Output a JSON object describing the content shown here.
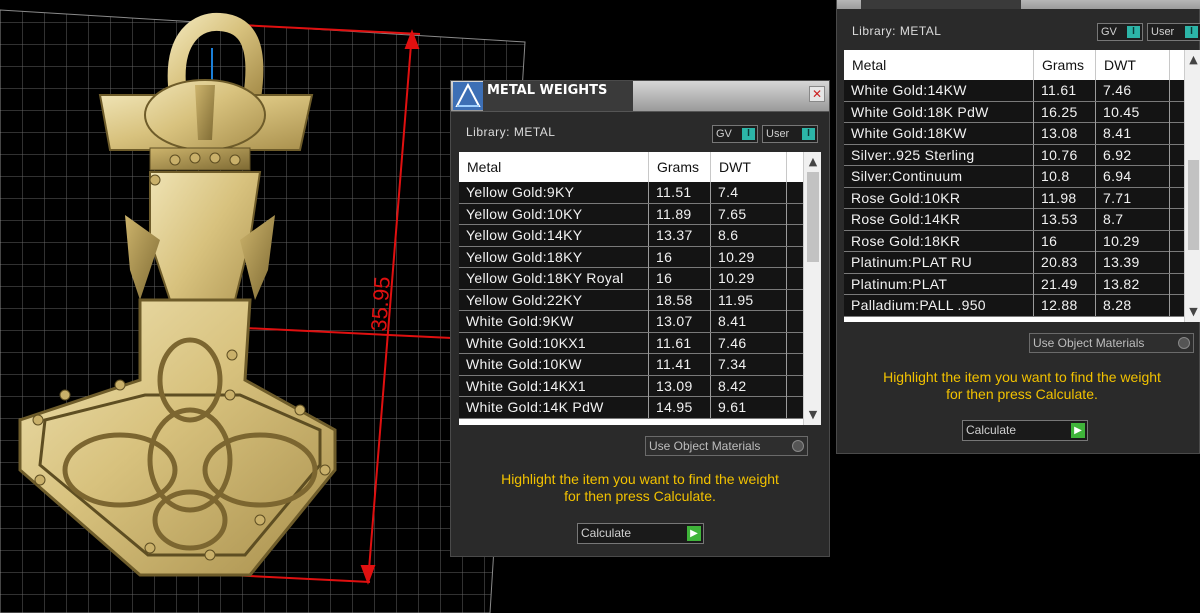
{
  "measurement": {
    "value": "35.95"
  },
  "colors": {
    "accent_green": "#3fb43a",
    "toggle_teal": "#2cb5a8",
    "hint_yellow": "#f2c200",
    "dim_red": "#e01010"
  },
  "main_dialog": {
    "title": "METAL WEIGHTS",
    "close_glyph": "✕",
    "library_label": "Library: METAL",
    "toggle_gv": "GV",
    "toggle_user": "User",
    "toggle_knob": "I",
    "columns": [
      "Metal",
      "Grams",
      "DWT"
    ],
    "rows": [
      [
        "Yellow Gold:9KY",
        "11.51",
        "7.4"
      ],
      [
        "Yellow Gold:10KY",
        "11.89",
        "7.65"
      ],
      [
        "Yellow Gold:14KY",
        "13.37",
        "8.6"
      ],
      [
        "Yellow Gold:18KY",
        "16",
        "10.29"
      ],
      [
        "Yellow Gold:18KY Royal",
        "16",
        "10.29"
      ],
      [
        "Yellow Gold:22KY",
        "18.58",
        "11.95"
      ],
      [
        "White Gold:9KW",
        "13.07",
        "8.41"
      ],
      [
        "White Gold:10KX1",
        "11.61",
        "7.46"
      ],
      [
        "White Gold:10KW",
        "11.41",
        "7.34"
      ],
      [
        "White Gold:14KX1",
        "13.09",
        "8.42"
      ],
      [
        "White Gold:14K PdW",
        "14.95",
        "9.61"
      ]
    ],
    "use_object_materials": "Use Object Materials",
    "hint_line1": "Highlight the item you want to find the weight",
    "hint_line2": "for then press Calculate.",
    "calculate_label": "Calculate",
    "scroll_up": "▲",
    "scroll_down": "▼"
  },
  "second_dialog": {
    "library_label": "Library: METAL",
    "toggle_gv": "GV",
    "toggle_user": "User",
    "toggle_knob": "I",
    "columns": [
      "Metal",
      "Grams",
      "DWT"
    ],
    "rows": [
      [
        "White Gold:14KW",
        "11.61",
        "7.46"
      ],
      [
        "White Gold:18K PdW",
        "16.25",
        "10.45"
      ],
      [
        "White Gold:18KW",
        "13.08",
        "8.41"
      ],
      [
        "Silver:.925 Sterling",
        "10.76",
        "6.92"
      ],
      [
        "Silver:Continuum",
        "10.8",
        "6.94"
      ],
      [
        "Rose Gold:10KR",
        "11.98",
        "7.71"
      ],
      [
        "Rose Gold:14KR",
        "13.53",
        "8.7"
      ],
      [
        "Rose Gold:18KR",
        "16",
        "10.29"
      ],
      [
        "Platinum:PLAT RU",
        "20.83",
        "13.39"
      ],
      [
        "Platinum:PLAT",
        "21.49",
        "13.82"
      ],
      [
        "Palladium:PALL .950",
        "12.88",
        "8.28"
      ]
    ],
    "use_object_materials": "Use Object Materials",
    "hint_line1": "Highlight the item you want to find the weight",
    "hint_line2": "for then press Calculate.",
    "calculate_label": "Calculate",
    "scroll_up": "▲",
    "scroll_down": "▼"
  }
}
